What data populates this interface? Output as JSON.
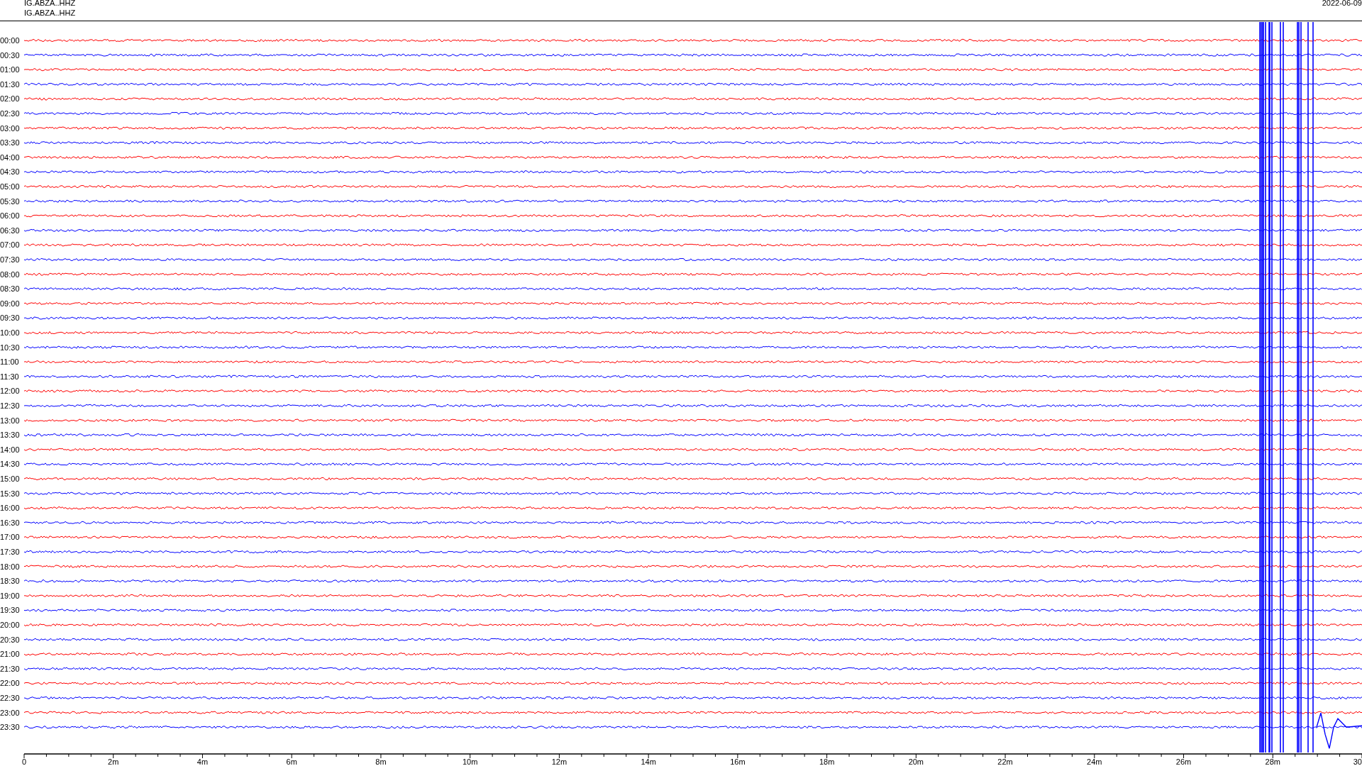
{
  "header": {
    "station_lines": [
      "IG.ABZA..HHZ",
      "IG.ABZA..HHZ"
    ],
    "date": "2022-06-09"
  },
  "rows": [
    {
      "label": "00:00",
      "color": "#ff0000"
    },
    {
      "label": "00:30",
      "color": "#0000ff"
    },
    {
      "label": "01:00",
      "color": "#ff0000"
    },
    {
      "label": "01:30",
      "color": "#0000ff"
    },
    {
      "label": "02:00",
      "color": "#ff0000"
    },
    {
      "label": "02:30",
      "color": "#0000ff"
    },
    {
      "label": "03:00",
      "color": "#ff0000"
    },
    {
      "label": "03:30",
      "color": "#0000ff"
    },
    {
      "label": "04:00",
      "color": "#ff0000"
    },
    {
      "label": "04:30",
      "color": "#0000ff"
    },
    {
      "label": "05:00",
      "color": "#ff0000"
    },
    {
      "label": "05:30",
      "color": "#0000ff"
    },
    {
      "label": "06:00",
      "color": "#ff0000"
    },
    {
      "label": "06:30",
      "color": "#0000ff"
    },
    {
      "label": "07:00",
      "color": "#ff0000"
    },
    {
      "label": "07:30",
      "color": "#0000ff"
    },
    {
      "label": "08:00",
      "color": "#ff0000"
    },
    {
      "label": "08:30",
      "color": "#0000ff"
    },
    {
      "label": "09:00",
      "color": "#ff0000"
    },
    {
      "label": "09:30",
      "color": "#0000ff"
    },
    {
      "label": "10:00",
      "color": "#ff0000"
    },
    {
      "label": "10:30",
      "color": "#0000ff"
    },
    {
      "label": "11:00",
      "color": "#ff0000"
    },
    {
      "label": "11:30",
      "color": "#0000ff"
    },
    {
      "label": "12:00",
      "color": "#ff0000"
    },
    {
      "label": "12:30",
      "color": "#0000ff"
    },
    {
      "label": "13:00",
      "color": "#ff0000"
    },
    {
      "label": "13:30",
      "color": "#0000ff"
    },
    {
      "label": "14:00",
      "color": "#ff0000"
    },
    {
      "label": "14:30",
      "color": "#0000ff"
    },
    {
      "label": "15:00",
      "color": "#ff0000"
    },
    {
      "label": "15:30",
      "color": "#0000ff"
    },
    {
      "label": "16:00",
      "color": "#ff0000"
    },
    {
      "label": "16:30",
      "color": "#0000ff"
    },
    {
      "label": "17:00",
      "color": "#ff0000"
    },
    {
      "label": "17:30",
      "color": "#0000ff"
    },
    {
      "label": "18:00",
      "color": "#ff0000"
    },
    {
      "label": "18:30",
      "color": "#0000ff"
    },
    {
      "label": "19:00",
      "color": "#ff0000"
    },
    {
      "label": "19:30",
      "color": "#0000ff"
    },
    {
      "label": "20:00",
      "color": "#ff0000"
    },
    {
      "label": "20:30",
      "color": "#0000ff"
    },
    {
      "label": "21:00",
      "color": "#ff0000"
    },
    {
      "label": "21:30",
      "color": "#0000ff"
    },
    {
      "label": "22:00",
      "color": "#ff0000"
    },
    {
      "label": "22:30",
      "color": "#0000ff"
    },
    {
      "label": "23:00",
      "color": "#ff0000"
    },
    {
      "label": "23:30",
      "color": "#0000ff"
    }
  ],
  "x_axis": {
    "tick_labels": [
      "0",
      "2m",
      "4m",
      "6m",
      "8m",
      "10m",
      "12m",
      "14m",
      "16m",
      "18m",
      "20m",
      "22m",
      "24m",
      "26m",
      "28m",
      "30"
    ]
  }
}
